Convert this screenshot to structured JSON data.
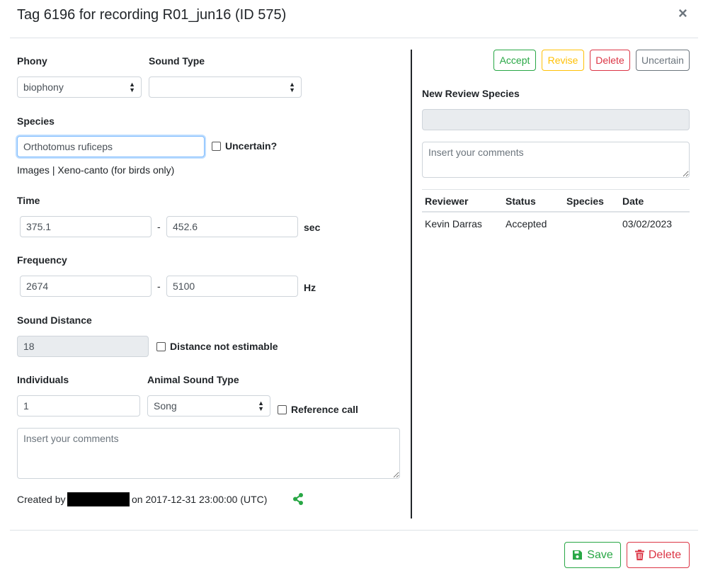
{
  "modal": {
    "title": "Tag 6196 for recording R01_jun16 (ID 575)",
    "close": "×"
  },
  "form": {
    "phony": {
      "label": "Phony",
      "value": "biophony"
    },
    "sound_type": {
      "label": "Sound Type",
      "value": ""
    },
    "species": {
      "label": "Species",
      "value": "Orthotomus ruficeps",
      "uncertain_label": "Uncertain?"
    },
    "links": {
      "images": "Images",
      "separator": "|",
      "xeno_canto": "Xeno-canto (for birds only)"
    },
    "time": {
      "label": "Time",
      "min": "375.1",
      "max": "452.6",
      "dash": "-",
      "unit": "sec"
    },
    "frequency": {
      "label": "Frequency",
      "min": "2674",
      "max": "5100",
      "dash": "-",
      "unit": "Hz"
    },
    "sound_distance": {
      "label": "Sound Distance",
      "value": "18",
      "not_estimable_label": "Distance not estimable"
    },
    "individuals": {
      "label": "Individuals",
      "value": "1"
    },
    "animal_sound_type": {
      "label": "Animal Sound Type",
      "value": "Song",
      "reference_label": "Reference call"
    },
    "comments": {
      "placeholder": "Insert your comments"
    },
    "created": {
      "prefix": "Created by",
      "suffix": "on 2017-12-31 23:00:00 (UTC)"
    }
  },
  "review": {
    "buttons": {
      "accept": "Accept",
      "revise": "Revise",
      "delete": "Delete",
      "uncertain": "Uncertain"
    },
    "new_species_label": "New Review Species",
    "comments_placeholder": "Insert your comments",
    "table": {
      "headers": [
        "Reviewer",
        "Status",
        "Species",
        "Date"
      ],
      "rows": [
        [
          "Kevin Darras",
          "Accepted",
          "",
          "03/02/2023"
        ]
      ]
    }
  },
  "footer": {
    "save": "Save",
    "delete": "Delete"
  },
  "colors": {
    "success": "#28a745",
    "warning": "#ffc107",
    "danger": "#dc3545",
    "secondary": "#6c757d"
  },
  "icons": {
    "share": "share-icon",
    "save": "floppy-disk-icon",
    "delete": "trash-icon"
  }
}
